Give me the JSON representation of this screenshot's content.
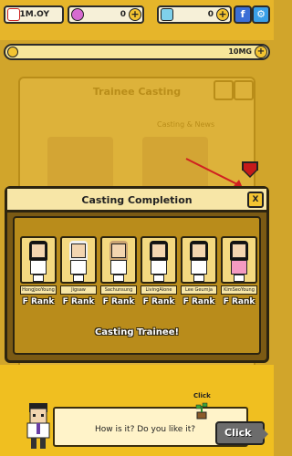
{
  "topbar": {
    "calendar_value": "1M.OY",
    "gem_value": "0",
    "ticket_value": "0"
  },
  "subbar": {
    "value": "10MG"
  },
  "background": {
    "title": "Trainee Casting",
    "subtitle": "Casting & News"
  },
  "modal": {
    "title": "Casting Completion",
    "close_label": "X",
    "result_text": "Casting Trainee!",
    "trainees": [
      {
        "name": "HongJooYoung",
        "rank": "F Rank",
        "hair": "#111111",
        "shirt": "#ffffff"
      },
      {
        "name": "Jigsaw",
        "rank": "F Rank",
        "hair": "#f0f0f0",
        "shirt": "#ffffff"
      },
      {
        "name": "Sachunsung",
        "rank": "F Rank",
        "hair": "#caa372",
        "shirt": "#ffffff"
      },
      {
        "name": "LivingAlone",
        "rank": "F Rank",
        "hair": "#111111",
        "shirt": "#ffffff"
      },
      {
        "name": "Lee Geumja",
        "rank": "F Rank",
        "hair": "#111111",
        "shirt": "#ffffff"
      },
      {
        "name": "KimSeoYoung",
        "rank": "F Rank",
        "hair": "#111111",
        "shirt": "#f49ac1"
      }
    ]
  },
  "dialog": {
    "text": "How is it? Do you like it?",
    "plant_label": "Click",
    "button_label": "Click"
  },
  "colors": {
    "accent_yellow": "#f3c431",
    "brown_panel": "#7b5a14",
    "red_gem": "#c51a1a"
  }
}
